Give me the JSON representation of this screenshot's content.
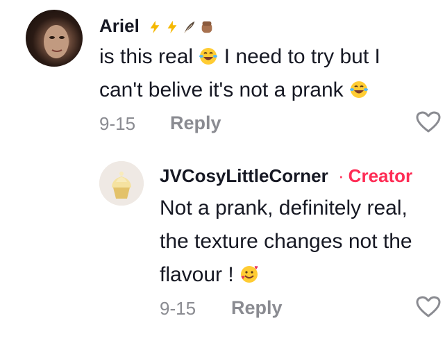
{
  "comment": {
    "author": "Ariel",
    "badge_emojis": [
      "lightning-emoji",
      "lightning-emoji",
      "feather-emoji",
      "fist-emoji"
    ],
    "lines": [
      "is this real",
      "I need to try but I",
      "can't belive it's not a prank"
    ],
    "date": "9-15",
    "reply_label": "Reply"
  },
  "reply": {
    "author": "JVCosyLittleCorner",
    "separator": "·",
    "role": "Creator",
    "lines": [
      "Not a prank, definitely real,",
      "the texture changes not the",
      "flavour !"
    ],
    "date": "9-15",
    "reply_label": "Reply"
  },
  "colors": {
    "creator": "#fe2c55",
    "muted": "#8a8b91",
    "text": "#161823"
  }
}
